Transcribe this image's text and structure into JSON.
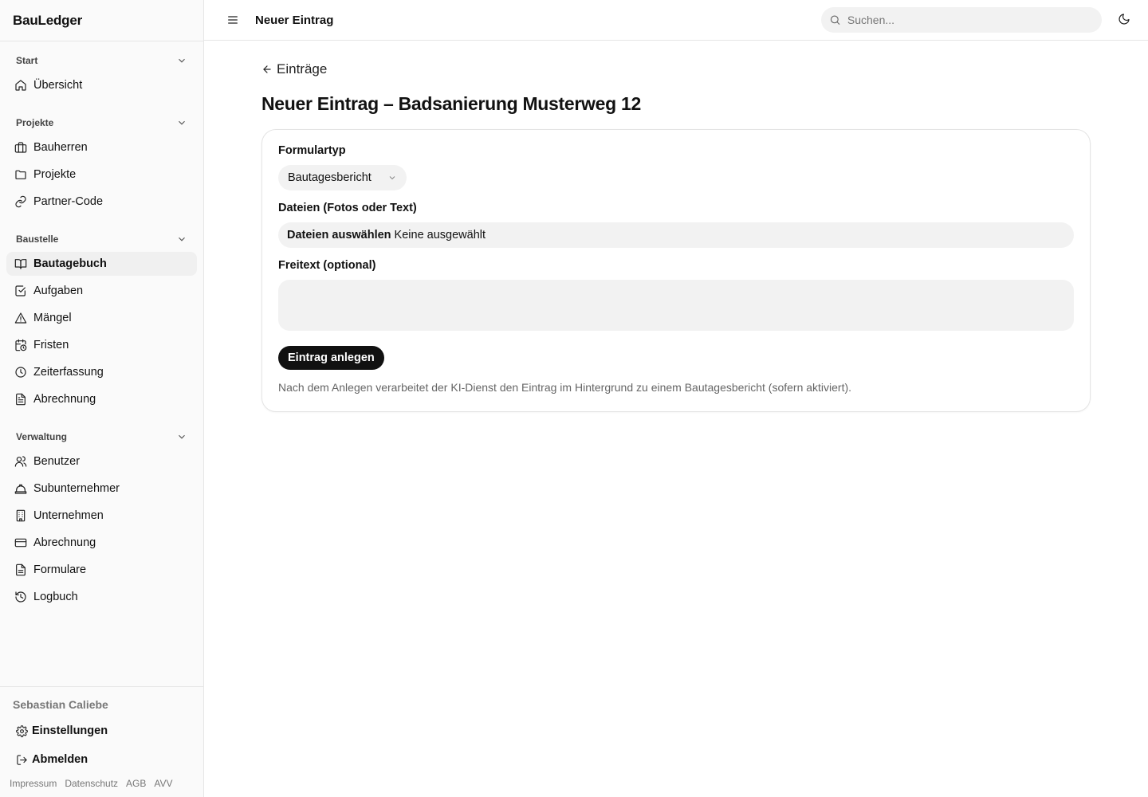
{
  "app": {
    "brand": "BauLedger"
  },
  "sidebar": {
    "groups": [
      {
        "title": "Start",
        "items": [
          {
            "label": "Übersicht",
            "icon": "home-icon"
          }
        ]
      },
      {
        "title": "Projekte",
        "items": [
          {
            "label": "Bauherren",
            "icon": "briefcase-icon"
          },
          {
            "label": "Projekte",
            "icon": "folder-icon"
          },
          {
            "label": "Partner-Code",
            "icon": "link-icon"
          }
        ]
      },
      {
        "title": "Baustelle",
        "items": [
          {
            "label": "Bautagebuch",
            "icon": "book-open-icon",
            "active": true
          },
          {
            "label": "Aufgaben",
            "icon": "check-square-icon"
          },
          {
            "label": "Mängel",
            "icon": "alert-triangle-icon"
          },
          {
            "label": "Fristen",
            "icon": "calendar-clock-icon"
          },
          {
            "label": "Zeiterfassung",
            "icon": "clock-icon"
          },
          {
            "label": "Abrechnung",
            "icon": "file-text-icon"
          }
        ]
      },
      {
        "title": "Verwaltung",
        "items": [
          {
            "label": "Benutzer",
            "icon": "users-icon"
          },
          {
            "label": "Subunternehmer",
            "icon": "hard-hat-icon"
          },
          {
            "label": "Unternehmen",
            "icon": "building-icon"
          },
          {
            "label": "Abrechnung",
            "icon": "credit-card-icon"
          },
          {
            "label": "Formulare",
            "icon": "file-icon"
          },
          {
            "label": "Logbuch",
            "icon": "history-icon"
          }
        ]
      }
    ],
    "footer": {
      "user_name": "Sebastian Caliebe",
      "settings_label": "Einstellungen",
      "logout_label": "Abmelden",
      "legal": [
        "Impressum",
        "Datenschutz",
        "AGB",
        "AVV"
      ]
    }
  },
  "topbar": {
    "title": "Neuer Eintrag",
    "search_placeholder": "Suchen..."
  },
  "page": {
    "back_label": "Einträge",
    "title": "Neuer Eintrag – Badsanierung Musterweg 12",
    "form": {
      "type_label": "Formulartyp",
      "type_value": "Bautagesbericht",
      "files_label": "Dateien (Fotos oder Text)",
      "files_button": "Dateien auswählen",
      "files_status": "Keine ausgewählt",
      "freetext_label": "Freitext (optional)",
      "freetext_value": "",
      "submit_label": "Eintrag anlegen",
      "hint": "Nach dem Anlegen verarbeitet der KI-Dienst den Eintrag im Hintergrund zu einem Bautagesbericht (sofern aktiviert)."
    }
  }
}
